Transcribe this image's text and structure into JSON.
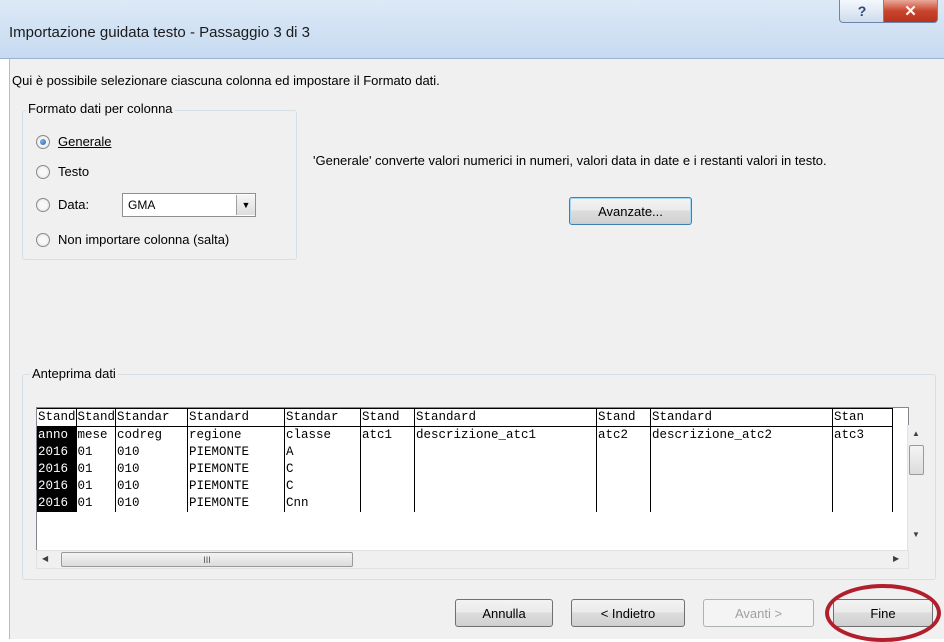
{
  "window": {
    "title": "Importazione guidata testo - Passaggio 3 di 3",
    "help_glyph": "?",
    "close_glyph": "✕"
  },
  "intro": "Qui è possibile selezionare ciascuna colonna ed impostare il Formato dati.",
  "format_group": {
    "label": "Formato dati per colonna",
    "options": [
      {
        "label": "Generale",
        "checked": true
      },
      {
        "label": "Testo",
        "checked": false
      },
      {
        "label": "Data:",
        "checked": false
      },
      {
        "label": "Non importare colonna (salta)",
        "checked": false
      }
    ],
    "date_format": "GMA"
  },
  "description": "'Generale' converte valori numerici in numeri, valori data in date e i restanti valori in testo.",
  "advanced_button": "Avanzate...",
  "preview": {
    "label": "Anteprima dati",
    "headers": [
      "Stand",
      "Stand",
      "Standar",
      "Standard",
      "Standar",
      "Stand",
      "Standard",
      "Stand",
      "Standard",
      "Stan"
    ],
    "rows": [
      [
        "anno",
        "mese",
        "codreg",
        "regione",
        "classe",
        "atc1",
        "descrizione_atc1",
        "atc2",
        "descrizione_atc2",
        "atc3"
      ],
      [
        "2016",
        "01",
        "010",
        "PIEMONTE",
        "A",
        "",
        "",
        "",
        "",
        ""
      ],
      [
        "2016",
        "01",
        "010",
        "PIEMONTE",
        "C",
        "",
        "",
        "",
        "",
        ""
      ],
      [
        "2016",
        "01",
        "010",
        "PIEMONTE",
        "C",
        "",
        "",
        "",
        "",
        ""
      ],
      [
        "2016",
        "01",
        "010",
        "PIEMONTE",
        "Cnn",
        "",
        "",
        "",
        "",
        ""
      ]
    ],
    "hscroll_grip": "III"
  },
  "buttons": {
    "cancel": "Annulla",
    "back": "< Indietro",
    "next": "Avanti >",
    "finish": "Fine"
  }
}
